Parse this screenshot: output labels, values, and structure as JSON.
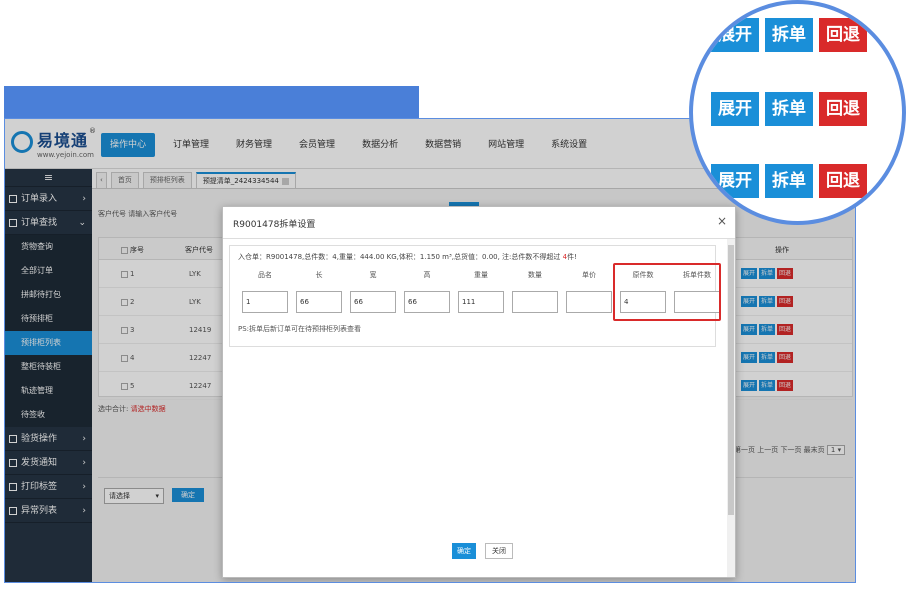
{
  "brand": {
    "name": "易境通",
    "url": "www.yejoin.com",
    "registered": "®"
  },
  "nav": [
    {
      "label": "操作中心",
      "active": true
    },
    {
      "label": "订单管理"
    },
    {
      "label": "财务管理"
    },
    {
      "label": "会员管理"
    },
    {
      "label": "数据分析"
    },
    {
      "label": "数据营销"
    },
    {
      "label": "网站管理"
    },
    {
      "label": "系统设置"
    }
  ],
  "sidebar": {
    "menu_icon": "≡",
    "groups_top": [
      {
        "label": "订单录入"
      },
      {
        "label": "订单查找"
      }
    ],
    "subs": [
      {
        "label": "货物查询"
      },
      {
        "label": "全部订单"
      },
      {
        "label": "拼邮待打包"
      },
      {
        "label": "待预排柜"
      },
      {
        "label": "预排柜列表",
        "active": true
      },
      {
        "label": "整柜待装柜"
      },
      {
        "label": "轨迹管理"
      },
      {
        "label": "待签收"
      }
    ],
    "groups_bottom": [
      {
        "label": "验货操作"
      },
      {
        "label": "发货通知"
      },
      {
        "label": "打印标签"
      },
      {
        "label": "异常列表"
      }
    ]
  },
  "tabs": [
    {
      "label": "首页"
    },
    {
      "label": "预排柜列表"
    },
    {
      "label": "预提清单_2424334544",
      "active": true
    }
  ],
  "background": {
    "customer_label": "客户代号 请输入客户代号",
    "table_headers": [
      "序号",
      "客户代号",
      "操作"
    ],
    "rows": [
      {
        "no": "1",
        "code": "LYK"
      },
      {
        "no": "2",
        "code": "LYK"
      },
      {
        "no": "3",
        "code": "12419"
      },
      {
        "no": "4",
        "code": "12247"
      },
      {
        "no": "5",
        "code": "12247"
      }
    ],
    "row_actions": [
      "展开",
      "拆单",
      "回退"
    ],
    "selected_total": "选中合计:",
    "selected_hint": "请选中数据",
    "pager": "第一页 上一页 下一页 最末页",
    "page_num": "1",
    "select_placeholder": "请选择",
    "confirm": "确定"
  },
  "modal": {
    "title": "R9001478拆单设置",
    "close": "×",
    "info_prefix": "入仓单：R9001478,总件数：4,重量：444.00 KG,体积：1.150 m³,总货值：0.00, 注:总件数不得超过 ",
    "info_limit": "4",
    "info_suffix": "件!",
    "columns": [
      "品名",
      "长",
      "宽",
      "高",
      "重量",
      "数量",
      "单价",
      "原件数",
      "拆单件数"
    ],
    "values": [
      "1",
      "66",
      "66",
      "66",
      "111",
      "",
      "",
      "4",
      ""
    ],
    "note": "PS:拆单后新订单可在待预排柜列表查看",
    "ok": "确定",
    "cancel": "关闭"
  },
  "magnifier": {
    "buttons": [
      "展开",
      "拆单",
      "回退"
    ]
  }
}
